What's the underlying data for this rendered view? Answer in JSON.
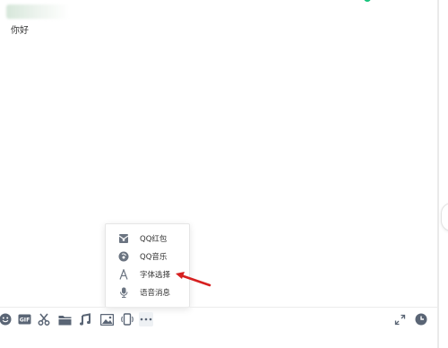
{
  "chat": {
    "message": "你好"
  },
  "more_menu": {
    "items": [
      {
        "label": "QQ红包",
        "icon": "red-packet-icon"
      },
      {
        "label": "QQ音乐",
        "icon": "music-icon"
      },
      {
        "label": "字体选择",
        "icon": "font-icon"
      },
      {
        "label": "语音消息",
        "icon": "microphone-icon"
      }
    ]
  },
  "toolbar": {
    "left_icons": [
      "emoji-icon",
      "gif-icon",
      "scissors-icon",
      "folder-icon",
      "music-note-icon",
      "image-icon",
      "phone-shake-icon",
      "more-icon"
    ],
    "right_icons": [
      "expand-icon",
      "history-clock-icon"
    ]
  },
  "colors": {
    "icon": "#5a6575",
    "online": "#19c37d",
    "annotation_arrow": "#d62020"
  }
}
